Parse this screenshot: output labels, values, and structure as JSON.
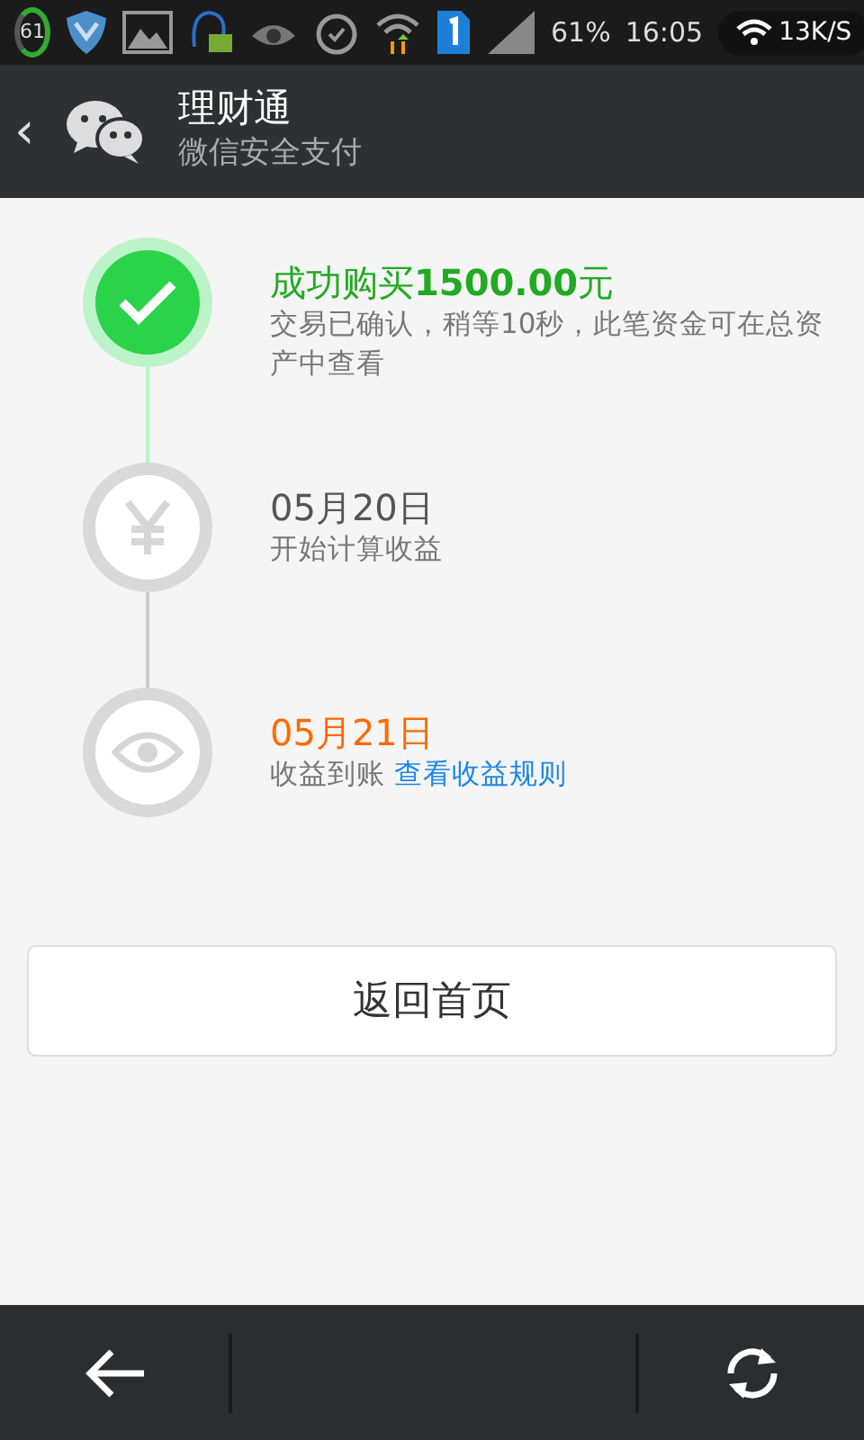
{
  "status_bar": {
    "battery_ring": "61",
    "battery_percent": "61%",
    "time": "16:05",
    "net_speed": "13K/S"
  },
  "header": {
    "back": "‹",
    "title": "理财通",
    "subtitle": "微信安全支付"
  },
  "steps": [
    {
      "kind": "done",
      "title": "成功购买**1500.00**元",
      "description": "交易已确认，稍等10秒，此笔资金可在总资产中查看"
    },
    {
      "kind": "pending",
      "title": "05月20日",
      "description": "开始计算收益"
    },
    {
      "kind": "future",
      "title": "05月21日",
      "description": "收益到账",
      "link": "查看收益规则"
    }
  ],
  "home_button": "返回首页"
}
